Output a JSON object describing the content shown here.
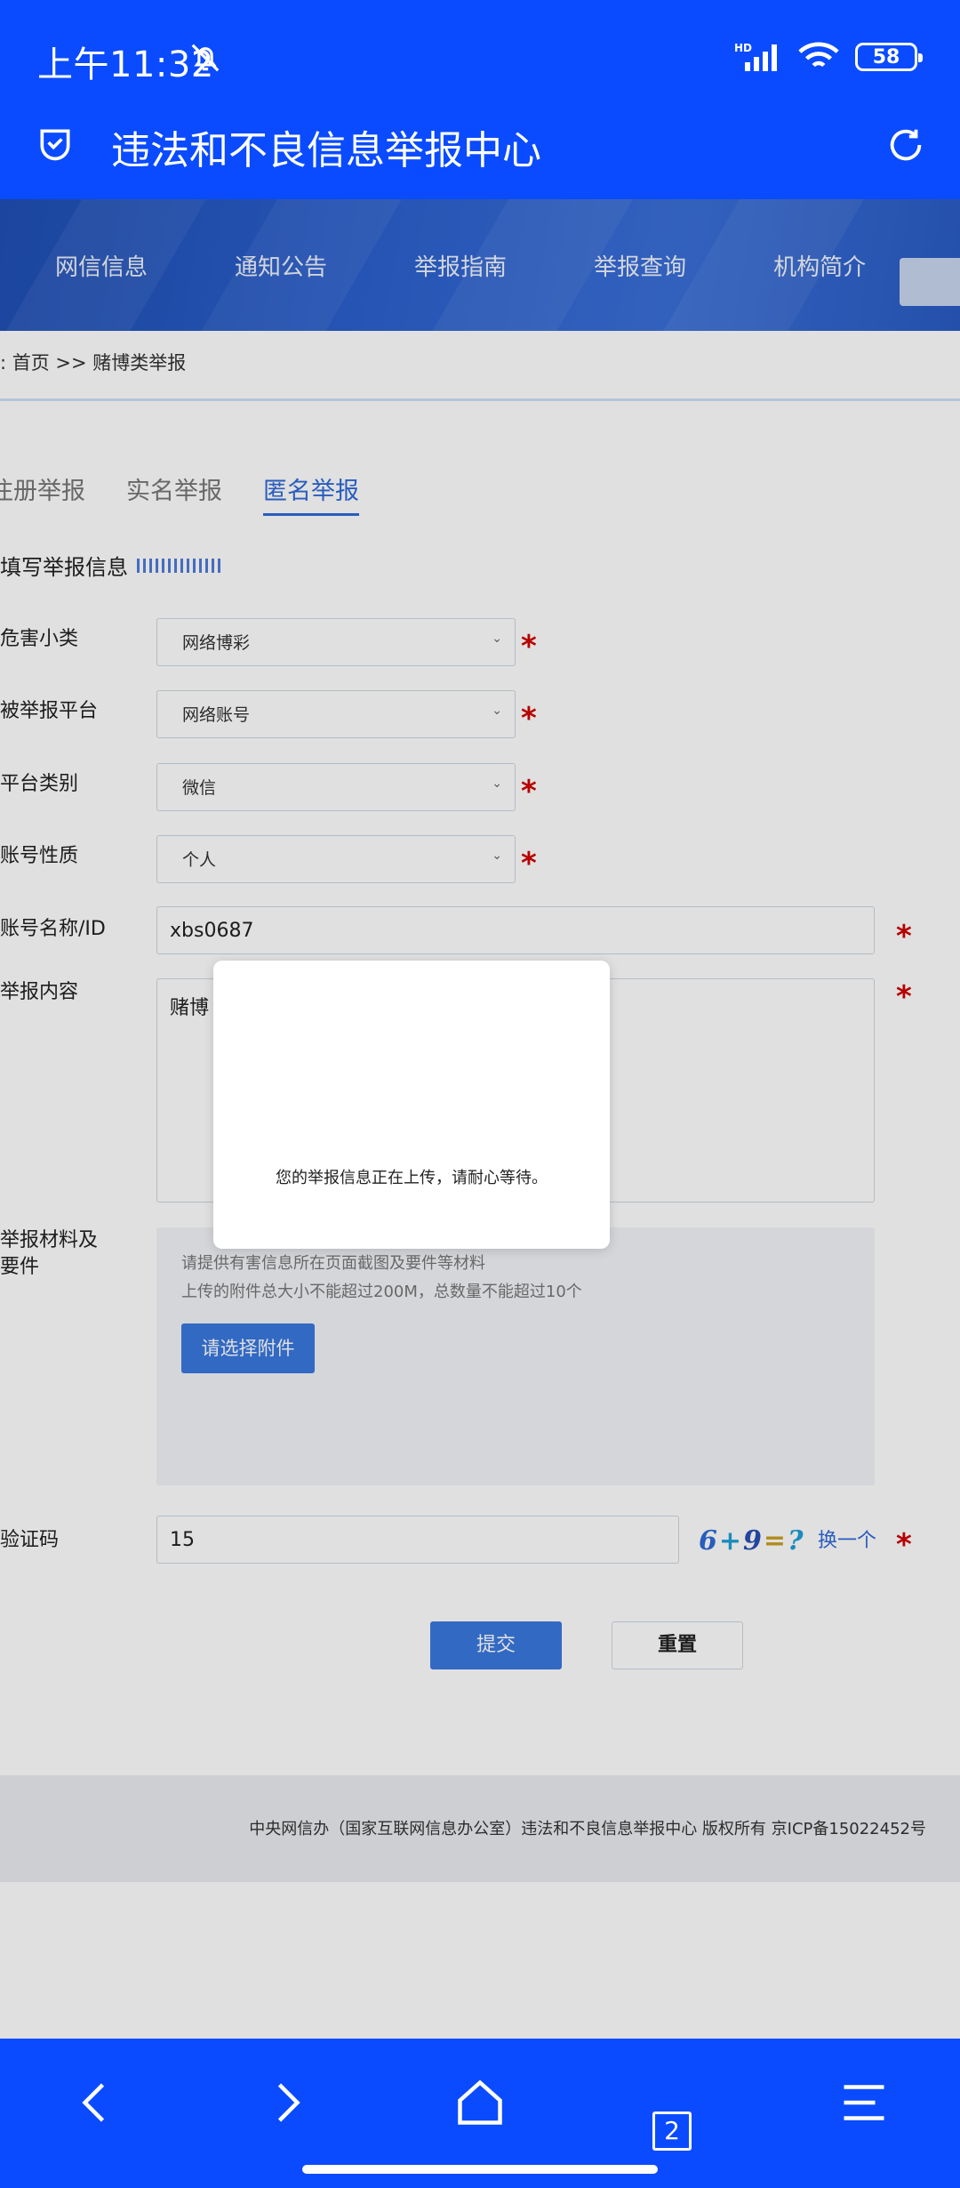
{
  "status_bar": {
    "time": "上午11:32",
    "network": "HD",
    "battery": "58"
  },
  "app": {
    "title": "违法和不良信息举报中心"
  },
  "nav": {
    "items": [
      "网信信息",
      "通知公告",
      "举报指南",
      "举报查询",
      "机构简介"
    ]
  },
  "breadcrumb": ": 首页 >> 赌博类举报",
  "tabs": [
    {
      "label": "注册举报",
      "active": false
    },
    {
      "label": "实名举报",
      "active": false
    },
    {
      "label": "匿名举报",
      "active": true
    }
  ],
  "section_title": "填写举报信息",
  "form": {
    "category": {
      "label": "危害小类",
      "value": "网络博彩"
    },
    "platform": {
      "label": "被举报平台",
      "value": "网络账号"
    },
    "platform_type": {
      "label": "平台类别",
      "value": "微信"
    },
    "account_nature": {
      "label": "账号性质",
      "value": "个人"
    },
    "account_id": {
      "label": "账号名称/ID",
      "value": "xbs0687"
    },
    "content": {
      "label": "举报内容",
      "value": "赌博"
    },
    "materials": {
      "label": "举报材料及要件",
      "hint1": "请提供有害信息所在页面截图及要件等材料",
      "hint2": "上传的附件总大小不能超过200M，总数量不能超过10个",
      "button": "请选择附件"
    },
    "captcha": {
      "label": "验证码",
      "value": "15",
      "image_text": "6+9=?",
      "change": "换一个"
    },
    "required_mark": "*"
  },
  "actions": {
    "submit": "提交",
    "reset": "重置"
  },
  "footer": "中央网信办（国家互联网信息办公室）违法和不良信息举报中心 版权所有 京ICP备15022452号",
  "modal": {
    "message": "您的举报信息正在上传，请耐心等待。"
  },
  "browser": {
    "tab_count": "2"
  },
  "colors": {
    "app_bar": "#0a4bff",
    "accent": "#2f6ad8",
    "required": "#d10000"
  }
}
